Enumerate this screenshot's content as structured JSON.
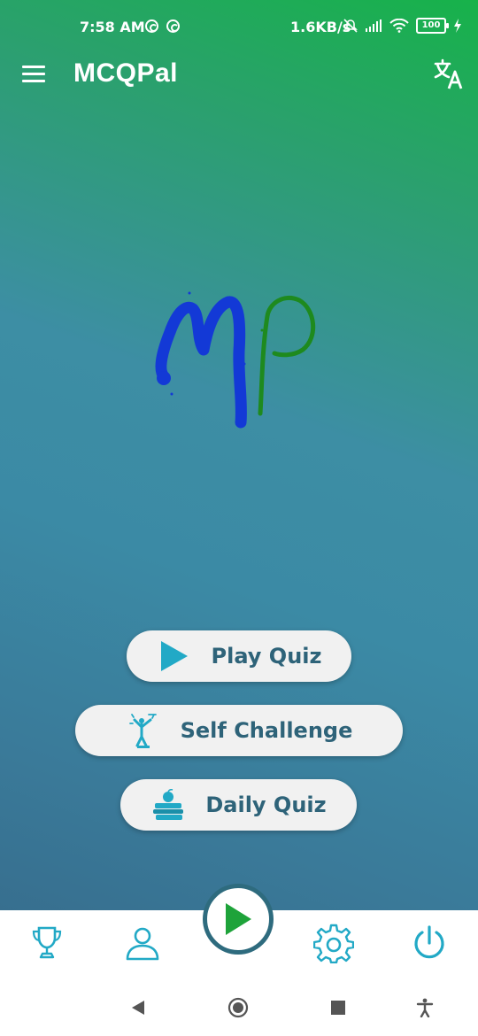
{
  "status_bar": {
    "time": "7:58 AM",
    "net_speed": "1.6KB/s",
    "battery": "100",
    "icons": [
      "notification-icon",
      "notification-icon",
      "mute-icon",
      "signal-icon",
      "wifi-icon",
      "battery-icon",
      "charging-icon"
    ]
  },
  "app_bar": {
    "title": "MCQPal",
    "menu_icon": "hamburger-menu-icon",
    "translate_icon": "translate-icon"
  },
  "logo": {
    "letters": [
      "M",
      "P"
    ],
    "colors": {
      "m": "#1339d6",
      "p": "#1e8a1e"
    }
  },
  "actions": {
    "play_quiz": {
      "label": "Play Quiz",
      "icon": "play-icon"
    },
    "self_challenge": {
      "label": "Self Challenge",
      "icon": "self-challenge-icon"
    },
    "daily_quiz": {
      "label": "Daily Quiz",
      "icon": "daily-quiz-icon"
    }
  },
  "bottom_nav": {
    "items": [
      {
        "icon": "trophy-icon"
      },
      {
        "icon": "profile-icon"
      },
      {
        "icon": "play-fab-icon"
      },
      {
        "icon": "settings-icon"
      },
      {
        "icon": "power-icon"
      }
    ]
  },
  "system_nav": {
    "items": [
      "back-icon",
      "home-icon",
      "recents-icon",
      "accessibility-icon"
    ]
  },
  "colors": {
    "accent": "#2e6379",
    "icon_cyan": "#22a9c6",
    "fab_green": "#1ea33a",
    "gradient_top": "#17b24a",
    "gradient_bottom": "#376f8f"
  }
}
